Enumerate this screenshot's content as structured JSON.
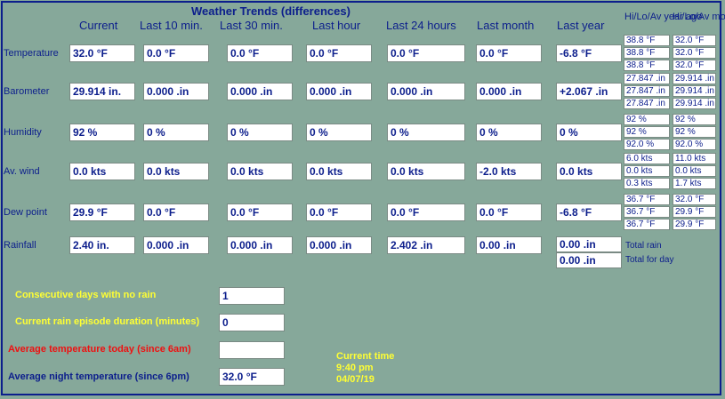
{
  "title": "Weather Trends (differences)",
  "columns": [
    "Current",
    "Last 10 min.",
    "Last 30 min.",
    "Last hour",
    "Last 24 hours",
    "Last month",
    "Last year"
  ],
  "hl_year_header": "Hi/Lo/Av year ago",
  "hl_month_header": "Hi/Lo/Av month ago",
  "rows": [
    {
      "label": "Temperature",
      "values": [
        "32.0 °F",
        "0.0 °F",
        "0.0 °F",
        "0.0 °F",
        "0.0 °F",
        "0.0 °F",
        "-6.8 °F"
      ],
      "year_ago": [
        "38.8 °F",
        "38.8 °F",
        "38.8 °F"
      ],
      "month_ago": [
        "32.0 °F",
        "32.0 °F",
        "32.0 °F"
      ]
    },
    {
      "label": "Barometer",
      "values": [
        "29.914 in.",
        "0.000 .in",
        "0.000 .in",
        "0.000 .in",
        "0.000 .in",
        "0.000 .in",
        "+2.067 .in"
      ],
      "year_ago": [
        "27.847 .in",
        "27.847 .in",
        "27.847 .in"
      ],
      "month_ago": [
        "29.914 .in",
        "29.914 .in",
        "29.914 .in"
      ]
    },
    {
      "label": "Humidity",
      "values": [
        "92 %",
        "0 %",
        "0 %",
        "0 %",
        "0 %",
        "0 %",
        "0 %"
      ],
      "year_ago": [
        "92 %",
        "92 %",
        "92.0 %"
      ],
      "month_ago": [
        "92 %",
        "92 %",
        "92.0 %"
      ]
    },
    {
      "label": "Av. wind",
      "values": [
        "0.0 kts",
        "0.0 kts",
        "0.0 kts",
        "0.0 kts",
        "0.0 kts",
        "-2.0 kts",
        "0.0 kts"
      ],
      "year_ago": [
        "6.0 kts",
        "0.0 kts",
        "0.3 kts"
      ],
      "month_ago": [
        "11.0 kts",
        "0.0 kts",
        "1.7 kts"
      ]
    },
    {
      "label": "Dew point",
      "values": [
        "29.9 °F",
        "0.0 °F",
        "0.0 °F",
        "0.0 °F",
        "0.0 °F",
        "0.0 °F",
        "-6.8 °F"
      ],
      "year_ago": [
        "36.7 °F",
        "36.7 °F",
        "36.7 °F"
      ],
      "month_ago": [
        "32.0 °F",
        "29.9 °F",
        "29.9 °F"
      ]
    }
  ],
  "rainfall": {
    "label": "Rainfall",
    "values": [
      "2.40 in.",
      "0.000 .in",
      "0.000 .in",
      "0.000 .in",
      "2.402 .in",
      "0.00 .in"
    ],
    "last_year_total": "0.00 .in",
    "last_year_day": "0.00 .in",
    "total_rain_label": "Total rain",
    "total_day_label": "Total for day"
  },
  "stats": {
    "no_rain_label": "Consecutive days with no rain",
    "no_rain_value": "1",
    "episode_label": "Current rain episode duration (minutes)",
    "episode_value": "0",
    "avg_today_label": "Average temperature today (since 6am)",
    "avg_today_value": "",
    "avg_night_label": "Average night temperature (since 6pm)",
    "avg_night_value": "32.0 °F"
  },
  "current_time": {
    "label": "Current time",
    "time": "9:40 pm",
    "date": "04/07/19"
  },
  "colors": {
    "background": "#86a89a",
    "accent": "#0c1e8c",
    "yellow": "#ffff33",
    "red": "#ee1111"
  }
}
